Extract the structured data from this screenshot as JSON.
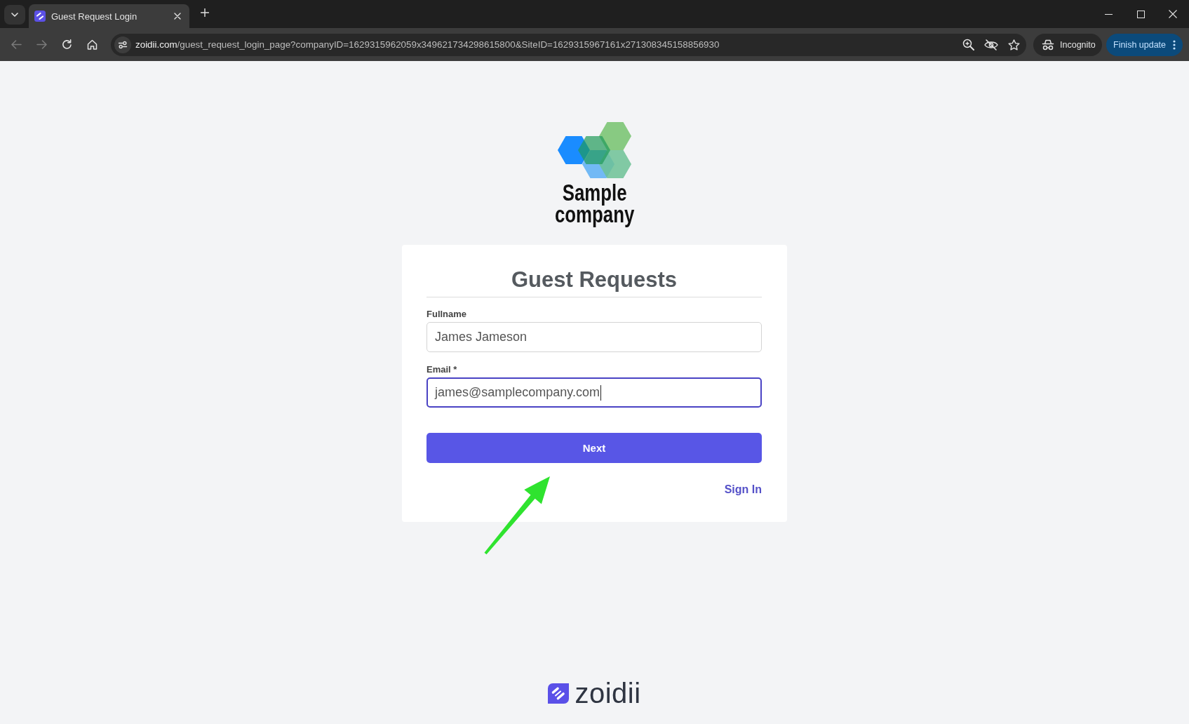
{
  "browser": {
    "tabs": [
      {
        "title": "Guest Request Login",
        "selected": true
      }
    ],
    "nav": [
      {
        "kind": "back",
        "disabled": true
      },
      {
        "kind": "forward",
        "disabled": true
      },
      {
        "kind": "reload",
        "disabled": false
      },
      {
        "kind": "home",
        "disabled": false
      }
    ],
    "url": {
      "host": "zoidii.com",
      "path": "/guest_request_login_page?companyID=1629315962059x349621734298615800&SiteID=1629315967161x271308345158856930"
    },
    "profile": "Incognito",
    "update_button": "Finish update"
  },
  "logo": {
    "lines": [
      "Sample",
      "company"
    ]
  },
  "card": {
    "title": "Guest Requests",
    "fields": [
      {
        "label": "Fullname",
        "value": "James Jameson",
        "focused": false
      },
      {
        "label": "Email *",
        "value": "james@samplecompany.com",
        "focused": true
      }
    ],
    "submit_button": "Next",
    "link": "Sign In"
  },
  "footer": {
    "brand": "zoidii"
  }
}
